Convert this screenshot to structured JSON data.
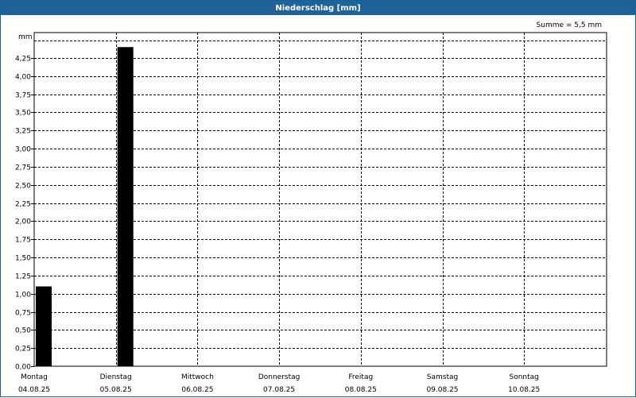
{
  "chart_data": {
    "type": "bar",
    "title": "Niederschlag [mm]",
    "ylabel": "mm",
    "summary": "Summe = 5,5 mm",
    "ylim": [
      0,
      4.6
    ],
    "grid": true,
    "yticks": [
      "0,00",
      "0,25",
      "0,50",
      "0,75",
      "1,00",
      "1,25",
      "1,50",
      "1,75",
      "2,00",
      "2,25",
      "2,50",
      "2,75",
      "3,00",
      "3,25",
      "3,50",
      "3,75",
      "4,00",
      "4,25"
    ],
    "categories": [
      {
        "day": "Montag",
        "date": "04.08.25"
      },
      {
        "day": "Dienstag",
        "date": "05.08.25"
      },
      {
        "day": "Mittwoch",
        "date": "06.08.25"
      },
      {
        "day": "Donnerstag",
        "date": "07.08.25"
      },
      {
        "day": "Freitag",
        "date": "08.08.25"
      },
      {
        "day": "Samstag",
        "date": "09.08.25"
      },
      {
        "day": "Sonntag",
        "date": "10.08.25"
      }
    ],
    "values": [
      1.1,
      4.4,
      0,
      0,
      0,
      0,
      0
    ],
    "bar_color": "#000000"
  }
}
